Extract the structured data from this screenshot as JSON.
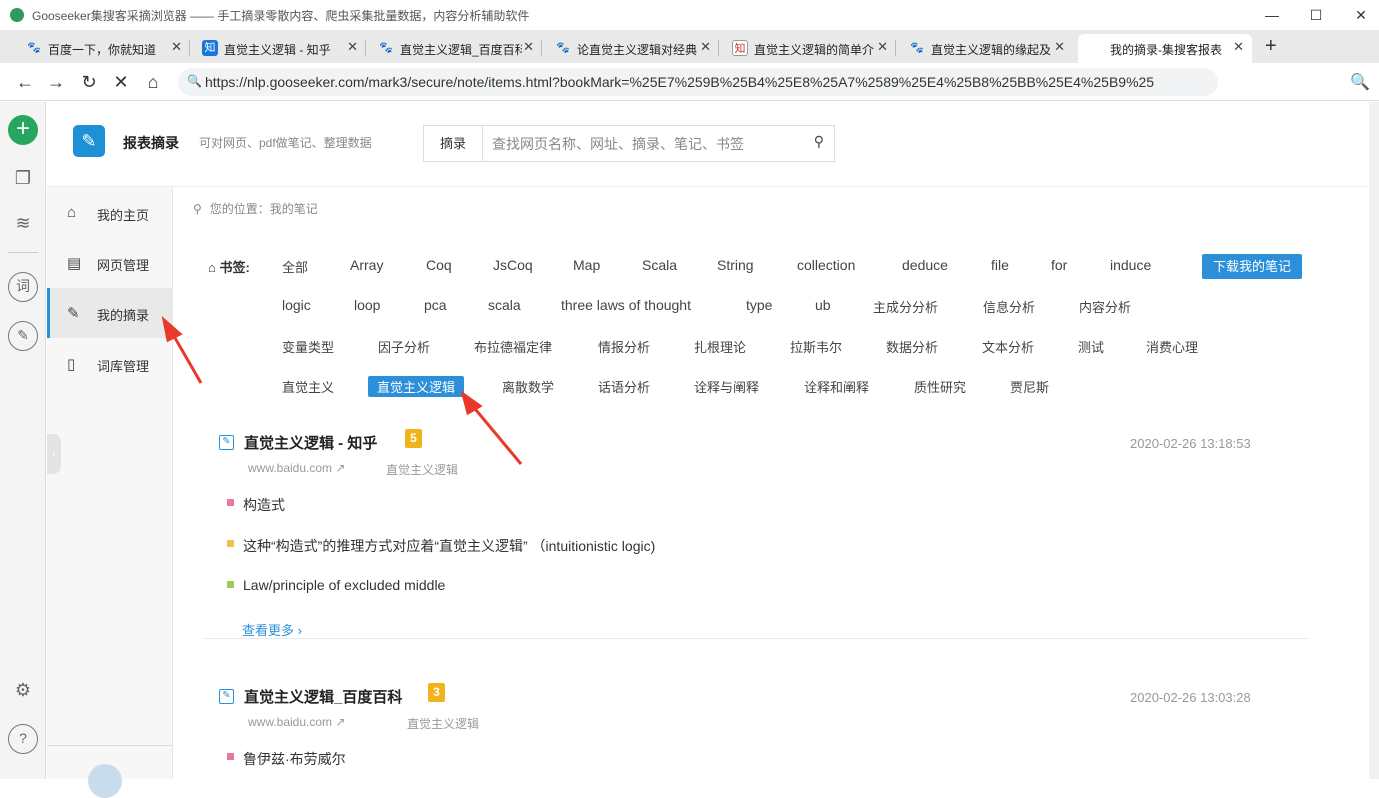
{
  "window": {
    "title": "Gooseeker集搜客采摘浏览器 —— 手工摘录零散内容、爬虫采集批量数据，内容分析辅助软件",
    "minimize": "—",
    "maximize": "☐",
    "close": "✕"
  },
  "tabs": [
    {
      "label": "百度一下，你就知道",
      "favicon": "baidu-paw-icon"
    },
    {
      "label": "直觉主义逻辑 - 知乎",
      "favicon": "zhihu-icon",
      "glyph": "知"
    },
    {
      "label": "直觉主义逻辑_百度百科",
      "favicon": "baidu-paw-icon"
    },
    {
      "label": "论直觉主义逻辑对经典",
      "favicon": "baidu-paw-icon"
    },
    {
      "label": "直觉主义逻辑的简单介",
      "favicon": "zhihu-icon",
      "glyph": "知"
    },
    {
      "label": "直觉主义逻辑的缘起及",
      "favicon": "baidu-paw-icon"
    },
    {
      "label": "我的摘录-集搜客报表",
      "favicon": "none"
    }
  ],
  "newtab": "+",
  "address": {
    "url": "https://nlp.gooseeker.com/mark3/secure/note/items.html?bookMark=%25E7%259B%25B4%25E8%25A7%2589%25E4%25B8%25BB%25E4%25B9%25"
  },
  "page": {
    "brand": "报表摘录",
    "tagline": "可对网页、pdf做笔记、整理数据",
    "search": {
      "category": "摘录",
      "placeholder": "查找网页名称、网址、摘录、笔记、书签"
    },
    "nav": [
      {
        "label": "我的主页",
        "icon": "home-icon"
      },
      {
        "label": "网页管理",
        "icon": "document-icon"
      },
      {
        "label": "我的摘录",
        "icon": "edit-note-icon",
        "active": true
      },
      {
        "label": "词库管理",
        "icon": "book-icon"
      }
    ],
    "breadcrumb": "您的位置：我的笔记",
    "bookmarks_label": "书签:",
    "download_label": "下载我的笔记",
    "tags": [
      "全部",
      "Array",
      "Coq",
      "JsCoq",
      "Map",
      "Scala",
      "String",
      "collection",
      "deduce",
      "file",
      "for",
      "induce",
      "logic",
      "loop",
      "pca",
      "scala",
      "three laws of thought",
      "type",
      "ub",
      "主成分分析",
      "信息分析",
      "内容分析",
      "变量类型",
      "因子分析",
      "布拉德福定律",
      "情报分析",
      "扎根理论",
      "拉斯韦尔",
      "数据分析",
      "文本分析",
      "测试",
      "消费心理",
      "直觉主义",
      "直觉主义逻辑",
      "离散数学",
      "话语分析",
      "诠释与阐释",
      "诠释和阐释",
      "质性研究",
      "贾尼斯"
    ],
    "selected_tag": "直觉主义逻辑",
    "notes": [
      {
        "title": "直觉主义逻辑 - 知乎",
        "count": "5",
        "source": "www.baidu.com",
        "tag": "直觉主义逻辑",
        "time": "2020-02-26 13:18:53",
        "items": [
          {
            "text": "构造式",
            "color": "#e8799a"
          },
          {
            "text": "这种“构造式”的推理方式对应着“直觉主义逻辑” （intuitionistic logic)",
            "color": "#f3c14b"
          },
          {
            "text": "Law/principle of excluded middle",
            "color": "#9ccc5a"
          }
        ],
        "more": "查看更多"
      },
      {
        "title": "直觉主义逻辑_百度百科",
        "count": "3",
        "source": "www.baidu.com",
        "tag": "直觉主义逻辑",
        "time": "2020-02-26 13:03:28",
        "items": [
          {
            "text": "鲁伊兹·布劳威尔",
            "color": "#e8799a"
          }
        ]
      }
    ]
  },
  "colors": {
    "accent": "#2b90d9",
    "badge": "#f1b31c",
    "annotation": "#e8392b"
  }
}
